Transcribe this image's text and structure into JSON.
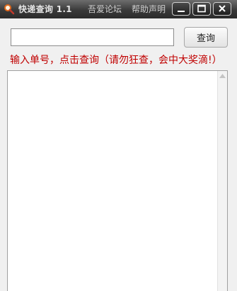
{
  "window": {
    "title": "快递查询 1.1",
    "links": {
      "forum": "吾爱论坛",
      "help": "帮助声明"
    },
    "controls": [
      "minimize",
      "maximize",
      "close"
    ]
  },
  "query": {
    "input_value": "",
    "input_placeholder": "",
    "button_label": "查询"
  },
  "hint": "输入单号，点击查询（请勿狂查，会中大奖滴!）",
  "results": {
    "text": ""
  },
  "icons": {
    "app": "magnifier-icon",
    "minimize": "minimize-icon",
    "maximize": "maximize-icon",
    "close": "close-icon",
    "scroll_up": "scroll-up-arrow-icon"
  },
  "colors": {
    "titlebar": "#3a3a3a",
    "hint_text": "#c00000",
    "background": "#f0f0f0"
  }
}
